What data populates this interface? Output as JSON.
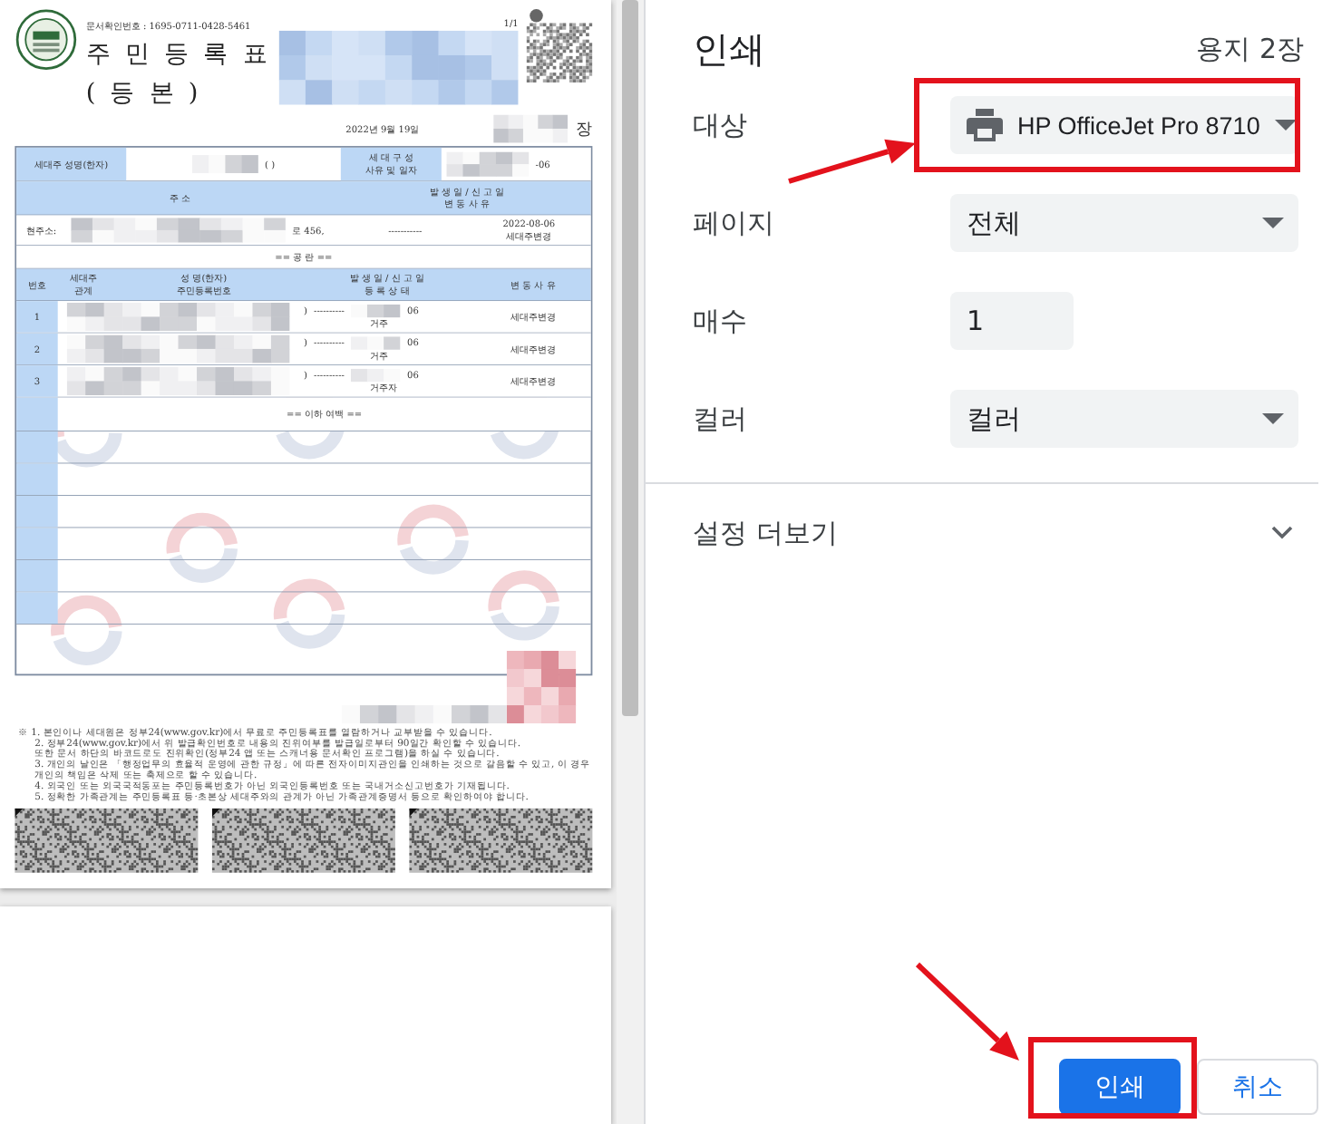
{
  "preview": {
    "pages": [
      {
        "kind": "document"
      },
      {
        "kind": "blank"
      }
    ],
    "document": {
      "confirmation_number": "문서확인번호 : 1695-0711-0428-5461",
      "page_number": "1/1",
      "title": "주 민 등 록 표",
      "subtitle": "( 등 본 )",
      "issue_date": "2022년 9월 19일",
      "sheet_suffix": "장",
      "head_row": {
        "label": "세대주 성명(한자)",
        "name_parens": "(            )",
        "composition_label": [
          "세 대 구 성",
          "사유 및 일자"
        ],
        "composition_tail": "-06"
      },
      "address_header": {
        "address": "주 소",
        "dates": [
          "발 생 일 / 신 고 일",
          "변 동 사 유"
        ]
      },
      "address_row": {
        "label": "현주소:",
        "address_tail": "로 456,",
        "date": "-----------",
        "reported": "2022-08-06",
        "reason": "세대주변경"
      },
      "blank_note": "== 공 란 ==",
      "member_columns": [
        {
          "lines": [
            "번호"
          ]
        },
        {
          "lines": [
            "세대주",
            "관계"
          ]
        },
        {
          "lines": [
            "성 명(한자)",
            "주민등록번호"
          ]
        },
        {
          "lines": [
            "발 생 일 / 신 고 일",
            "등 록 상 태"
          ]
        },
        {
          "lines": [
            "변 동 사 유"
          ]
        }
      ],
      "members": [
        {
          "number": "1",
          "paren": ")",
          "date": "----------",
          "date_tail": "06",
          "status": "거주",
          "reason": "세대주변경"
        },
        {
          "number": "2",
          "paren": ")",
          "date": "----------",
          "date_tail": "06",
          "status": "거주",
          "reason": "세대주변경"
        },
        {
          "number": "3",
          "paren": ")",
          "date": "----------",
          "date_tail": "06",
          "status": "거주자",
          "reason": "세대주변경"
        }
      ],
      "end_note": "== 이하 여백 ==",
      "notes": [
        "※ 1. 본인이나 세대원은 정부24(www.gov.kr)에서 무료로 주민등록표를 열람하거나 교부받을 수 있습니다.",
        "2. 정부24(www.gov.kr)에서 위 발급확인번호로 내용의 진위여부를 발급일로부터 90일간 확인할 수 있습니다.",
        "또한 문서 하단의 바코드로도 진위확인(정부24 앱 또는 스캐너용 문서확인 프로그램)을 하실 수 있습니다.",
        "3. 개인의 날인은 「행정업무의 효율적 운영에 관한 규정」에 따른 전자이미지관인을 인쇄하는 것으로 갈음할 수 있고, 이 경우",
        "개인의 책임은 삭제 또는 축제으로 할 수 있습니다.",
        "4. 외국인 또는 외국국적동포는 주민등록번호가 아닌 외국인등록번호 또는 국내거소신고번호가 기재됩니다.",
        "5. 정확한 가족관계는 주민등록표 등·초본상 세대주와의 관계가 아닌 가족관계증명서 등으로 확인하여야 합니다."
      ]
    }
  },
  "print_panel": {
    "title": "인쇄",
    "sheet_count": "용지 2장",
    "settings": [
      {
        "kind": "destination",
        "label": "대상",
        "value": "HP OfficeJet Pro 8710",
        "highlighted": true
      },
      {
        "kind": "select",
        "label": "페이지",
        "value": "전체",
        "highlighted": false
      },
      {
        "kind": "number",
        "label": "매수",
        "value": "1",
        "highlighted": false
      },
      {
        "kind": "select",
        "label": "컬러",
        "value": "컬러",
        "highlighted": false
      }
    ],
    "more_settings": {
      "label": "설정 더보기",
      "expanded": false
    },
    "buttons": [
      {
        "kind": "primary",
        "label": "인쇄",
        "highlighted": true
      },
      {
        "kind": "secondary",
        "label": "취소",
        "highlighted": false
      }
    ]
  }
}
